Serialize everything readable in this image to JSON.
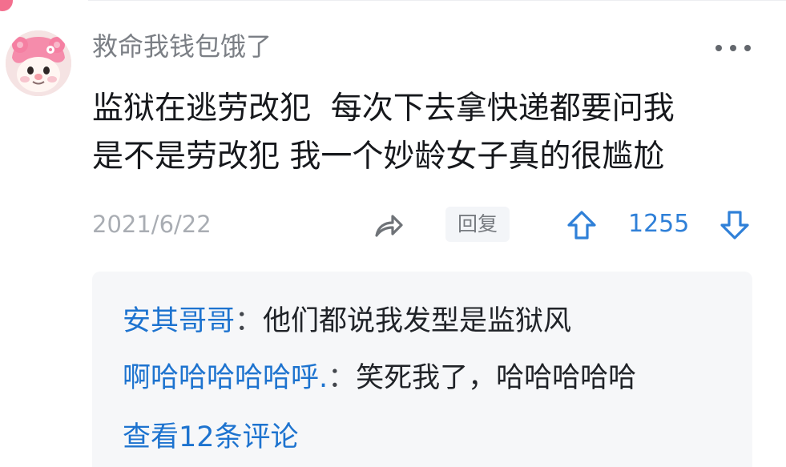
{
  "comment": {
    "username": "救命我钱包饿了",
    "body_lines": [
      "监狱在逃劳改犯  每次下去拿快递都要问我",
      "是不是劳改犯 我一个妙龄女子真的很尴尬"
    ],
    "date": "2021/6/22",
    "reply_label": "回复",
    "vote_count": "1255"
  },
  "replies": [
    {
      "name": "安其哥哥",
      "separator": "：",
      "text": "他们都说我发型是监狱风"
    },
    {
      "name": "啊哈哈哈哈哈呼.",
      "separator": "：",
      "text": "笑死我了，哈哈哈哈哈"
    }
  ],
  "view_more_label": "查看12条评论",
  "colors": {
    "accent_blue": "#1d73cf",
    "vote_blue": "#2f80d8",
    "username_gray": "#7b7f85",
    "panel_background": "#f6f7f9",
    "avatar_pink": "#f36f8e"
  },
  "icons": {
    "more": "more-dots-icon",
    "share": "share-arrow-icon",
    "upvote": "upvote-arrow-icon",
    "downvote": "downvote-arrow-icon",
    "avatar": "pink-bear-avatar"
  }
}
